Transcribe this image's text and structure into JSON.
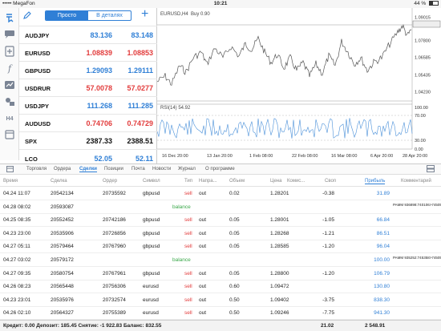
{
  "status": {
    "carrier": "••••• MegaFon",
    "time": "10:21",
    "battery": "44 %",
    "battery_level": 0.44
  },
  "toolbar": {
    "icons": [
      "pencil-icon",
      "hand-tap-icon",
      "chat-icon",
      "document-plus-icon",
      "function-icon",
      "indicators-icon",
      "users-icon",
      "period-icon",
      "settings-icon"
    ],
    "period_label": "H4"
  },
  "quotes": {
    "mode_simple": "Просто",
    "mode_detailed": "В деталях",
    "rows": [
      {
        "symbol": "AUDJPY",
        "bid": "83.136",
        "ask": "83.148",
        "bid_color": "blue",
        "ask_color": "blue"
      },
      {
        "symbol": "EURUSD",
        "bid": "1.08839",
        "ask": "1.08853",
        "bid_color": "red",
        "ask_color": "red"
      },
      {
        "symbol": "GBPUSD",
        "bid": "1.29093",
        "ask": "1.29111",
        "bid_color": "blue",
        "ask_color": "blue"
      },
      {
        "symbol": "USDRUR",
        "bid": "57.0078",
        "ask": "57.0277",
        "bid_color": "red",
        "ask_color": "red"
      },
      {
        "symbol": "USDJPY",
        "bid": "111.268",
        "ask": "111.285",
        "bid_color": "blue",
        "ask_color": "blue"
      },
      {
        "symbol": "AUDUSD",
        "bid": "0.74706",
        "ask": "0.74729",
        "bid_color": "red",
        "ask_color": "red"
      },
      {
        "symbol": "SPX",
        "bid": "2387.33",
        "ask": "2388.51",
        "bid_color": "black",
        "ask_color": "black"
      },
      {
        "symbol": "LCO",
        "bid": "52.05",
        "ask": "52.11",
        "bid_color": "blue",
        "ask_color": "blue"
      }
    ]
  },
  "chart": {
    "title": "EURUSD,H4",
    "overlay": "Buy 0.90",
    "price_ticks": [
      "1.09015",
      "1.08839",
      "1.07800",
      "1.06585",
      "1.05435",
      "1.04230"
    ],
    "current_price": "1.08839",
    "rsi_label": "RSI(14) 54.92",
    "rsi_ticks": [
      "100.00",
      "70.00",
      "30.00",
      "0.00"
    ],
    "date_ticks": [
      "16 Dec 20:00",
      "13 Jan 20:00",
      "1 Feb 08:00",
      "22 Feb 08:00",
      "16 Mar 08:00",
      "6 Apr 20:00",
      "28 Apr 20:00"
    ],
    "up_color": "#2f7fd6",
    "line_color": "#555555"
  },
  "tabs": {
    "items": [
      "Торговля",
      "Ордера",
      "Сделки",
      "Позиции",
      "Почта",
      "Новости",
      "Журнал",
      "О программе"
    ],
    "active": "Сделки"
  },
  "table": {
    "headers": [
      "Время",
      "Сделка",
      "Ордер",
      "Символ",
      "Тип",
      "Напра...",
      "Объем",
      "Цена",
      "Комис...",
      "Своп",
      "Прибыль",
      "Комментарий"
    ],
    "rows": [
      {
        "time": "04.24 11:07",
        "deal": "20542134",
        "order": "20735592",
        "symbol": "gbpusd",
        "type": "sell",
        "dir": "out",
        "volume": "0.02",
        "price": "1.28201",
        "commission": "",
        "swap": "-0.38",
        "profit": "31.89",
        "comment": ""
      },
      {
        "time": "04.28 08:02",
        "deal": "20593087",
        "order": "",
        "symbol": "",
        "type": "balance",
        "dir": "",
        "volume": "",
        "price": "",
        "commission": "",
        "swap": "",
        "profit": "",
        "comment": "PAMM 936898:740106>745050"
      },
      {
        "time": "04.25 08:35",
        "deal": "20552452",
        "order": "20742186",
        "symbol": "gbpusd",
        "type": "sell",
        "dir": "out",
        "volume": "0.05",
        "price": "1.28001",
        "commission": "",
        "swap": "-1.05",
        "profit": "66.84",
        "comment": ""
      },
      {
        "time": "04.23 23:00",
        "deal": "20535906",
        "order": "20726856",
        "symbol": "gbpusd",
        "type": "sell",
        "dir": "out",
        "volume": "0.05",
        "price": "1.28268",
        "commission": "",
        "swap": "-1.21",
        "profit": "86.51",
        "comment": ""
      },
      {
        "time": "04.27 05:11",
        "deal": "20579464",
        "order": "20767960",
        "symbol": "gbpusd",
        "type": "sell",
        "dir": "out",
        "volume": "0.05",
        "price": "1.28585",
        "commission": "",
        "swap": "-1.20",
        "profit": "96.04",
        "comment": ""
      },
      {
        "time": "04.27 03:02",
        "deal": "20579172",
        "order": "",
        "symbol": "",
        "type": "balance",
        "dir": "",
        "volume": "",
        "price": "",
        "commission": "",
        "swap": "",
        "profit": "100.00",
        "comment": "PAMM 935252:745358>745050"
      },
      {
        "time": "04.27 09:35",
        "deal": "20580754",
        "order": "20767961",
        "symbol": "gbpusd",
        "type": "sell",
        "dir": "out",
        "volume": "0.05",
        "price": "1.28800",
        "commission": "",
        "swap": "-1.20",
        "profit": "106.79",
        "comment": ""
      },
      {
        "time": "04.26 08:23",
        "deal": "20565448",
        "order": "20756306",
        "symbol": "eurusd",
        "type": "sell",
        "dir": "out",
        "volume": "0.60",
        "price": "1.09472",
        "commission": "",
        "swap": "",
        "profit": "130.80",
        "comment": ""
      },
      {
        "time": "04.23 23:01",
        "deal": "20535976",
        "order": "20732574",
        "symbol": "eurusd",
        "type": "sell",
        "dir": "out",
        "volume": "0.50",
        "price": "1.09402",
        "commission": "",
        "swap": "-3.75",
        "profit": "838.30",
        "comment": ""
      },
      {
        "time": "04.26 02:10",
        "deal": "20564327",
        "order": "20755389",
        "symbol": "eurusd",
        "type": "sell",
        "dir": "out",
        "volume": "0.50",
        "price": "1.09246",
        "commission": "",
        "swap": "-7.75",
        "profit": "941.30",
        "comment": ""
      }
    ]
  },
  "footer": {
    "summary": "Кредит: 0.00 Депозит: 185.45 Снятие: -1 922.83 Баланс: 832.55",
    "swap_total": "21.02",
    "profit_total": "2 548.91"
  }
}
